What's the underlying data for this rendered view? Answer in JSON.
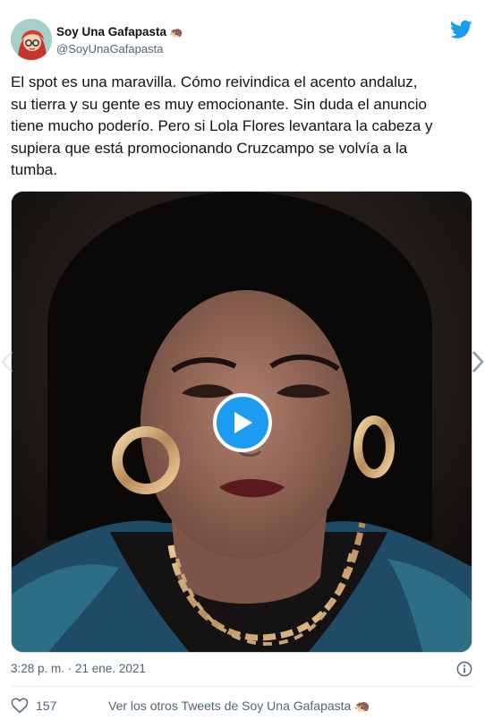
{
  "author": {
    "name": "Soy Una Gafapasta",
    "emoji": "🦔",
    "handle": "@SoyUnaGafapasta"
  },
  "tweet": {
    "text": "El spot es una maravilla. Cómo reivindica el acento andaluz,\nsu tierra y su gente es muy emocionante. Sin duda el anuncio\ntiene mucho poderío. Pero si Lola Flores levantara la cabeza y\nsupiera que está promocionando Cruzcampo se volvía a la\ntumba.",
    "timestamp": "3:28 p. m. · 21 ene. 2021"
  },
  "media": {
    "type": "video",
    "play_icon": "play-icon"
  },
  "footer": {
    "like_count": "157",
    "others_label": "Ver los otros Tweets de Soy Una Gafapasta",
    "others_emoji": "🦔"
  },
  "icons": {
    "brand": "twitter-bird-icon",
    "info": "info-icon",
    "like": "heart-icon"
  },
  "colors": {
    "accent": "#1d9bf0",
    "text": "#0f1419",
    "muted": "#536471"
  }
}
